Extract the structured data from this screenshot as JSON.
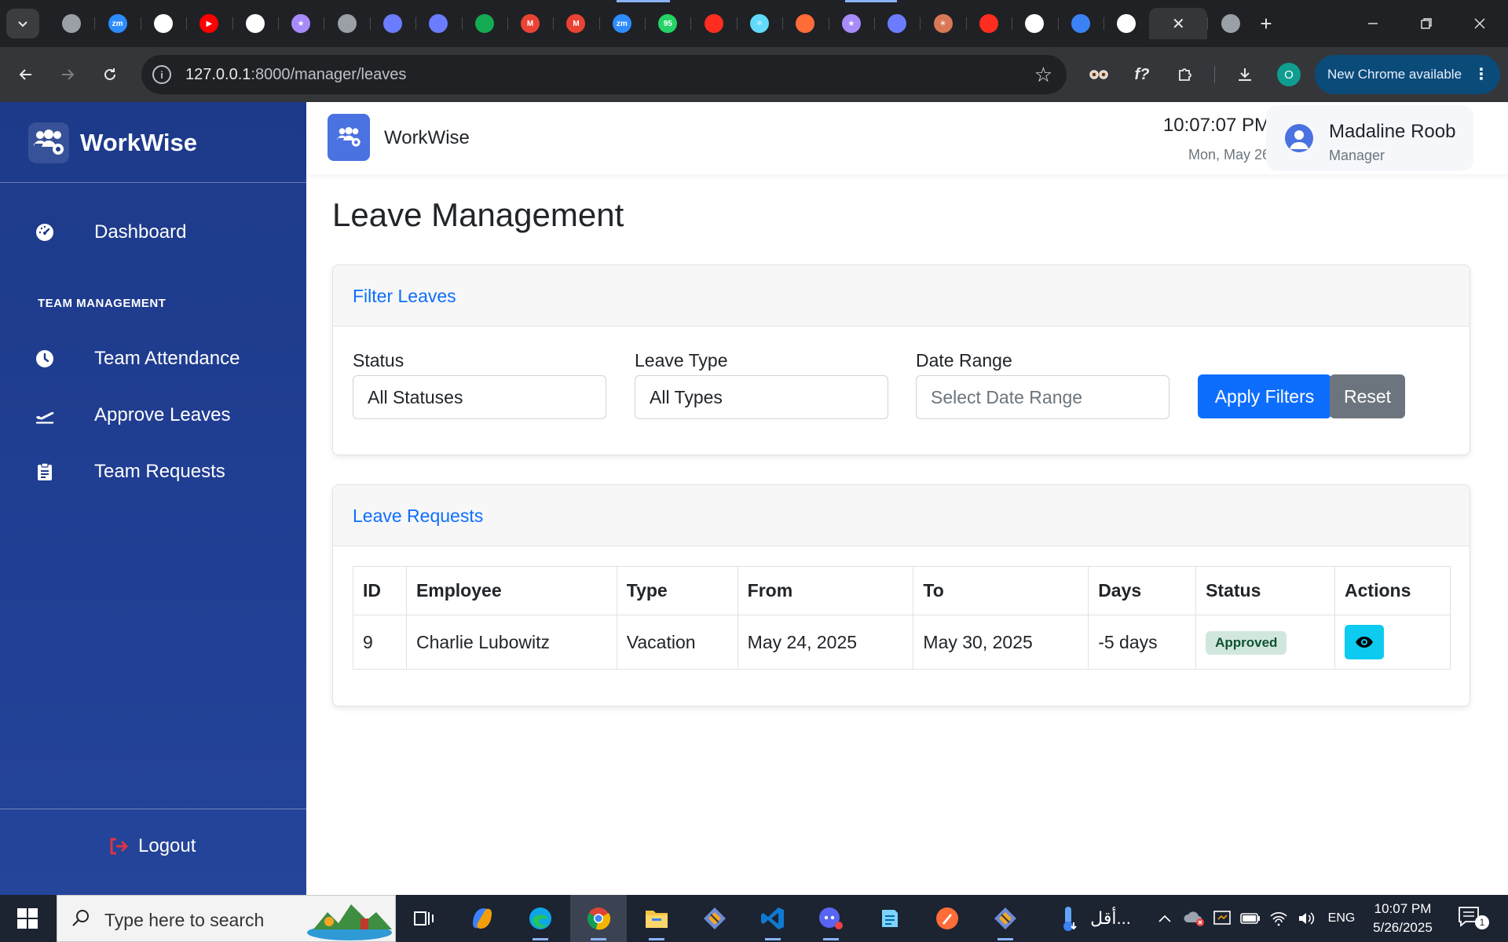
{
  "browser": {
    "url_host": "127.0.0.1",
    "url_path": ":8000/manager/leaves",
    "update_label": "New Chrome available",
    "profile_initial": "O",
    "tabs": [
      {
        "icon": "chrome-icon",
        "color": "#9aa0a6",
        "glyph": ""
      },
      {
        "icon": "zoom-icon",
        "color": "#2d8cff",
        "glyph": "zm"
      },
      {
        "icon": "github-icon",
        "color": "#ffffff",
        "glyph": ""
      },
      {
        "icon": "youtube-icon",
        "color": "#ff0000",
        "glyph": "▶"
      },
      {
        "icon": "openai-icon",
        "color": "#ffffff",
        "glyph": ""
      },
      {
        "icon": "vite-icon",
        "color": "#a78bfa",
        "glyph": "★"
      },
      {
        "icon": "globe-icon",
        "color": "#9aa0a6",
        "glyph": ""
      },
      {
        "icon": "tailwind-icon",
        "color": "#6b7cff",
        "glyph": ""
      },
      {
        "icon": "tailwind-icon",
        "color": "#6b7cff",
        "glyph": ""
      },
      {
        "icon": "mongodb-icon",
        "color": "#13aa52",
        "glyph": ""
      },
      {
        "icon": "gmail-icon",
        "color": "#ea4335",
        "glyph": "M"
      },
      {
        "icon": "gmail-icon",
        "color": "#ea4335",
        "glyph": "M"
      },
      {
        "icon": "zoom-icon",
        "color": "#2d8cff",
        "glyph": "zm"
      },
      {
        "icon": "whatsapp-icon",
        "color": "#25d366",
        "glyph": "95"
      },
      {
        "icon": "laravel-icon",
        "color": "#ff2d20",
        "glyph": ""
      },
      {
        "icon": "react-icon",
        "color": "#61dafb",
        "glyph": "⚛"
      },
      {
        "icon": "postman-icon",
        "color": "#ff6c37",
        "glyph": ""
      },
      {
        "icon": "vite-icon",
        "color": "#a78bfa",
        "glyph": "★"
      },
      {
        "icon": "tailwind-icon",
        "color": "#6b7cff",
        "glyph": ""
      },
      {
        "icon": "claude-icon",
        "color": "#d97757",
        "glyph": "✳"
      },
      {
        "icon": "laravel-icon",
        "color": "#ff2d20",
        "glyph": ""
      },
      {
        "icon": "openai-icon",
        "color": "#ffffff",
        "glyph": ""
      },
      {
        "icon": "share-icon",
        "color": "#3b82f6",
        "glyph": ""
      },
      {
        "icon": "terminal-icon",
        "color": "#ffffff",
        "glyph": ""
      },
      {
        "icon": "close-icon",
        "color": "#e8eaed",
        "glyph": "✕",
        "active": true
      },
      {
        "icon": "globe-icon",
        "color": "#9aa0a6",
        "glyph": ""
      }
    ]
  },
  "app": {
    "brand": "WorkWise",
    "sidebar": {
      "dashboard": "Dashboard",
      "section_heading": "TEAM MANAGEMENT",
      "items": [
        {
          "label": "Team Attendance",
          "icon": "clock-icon"
        },
        {
          "label": "Approve Leaves",
          "icon": "plane-icon"
        },
        {
          "label": "Team Requests",
          "icon": "clipboard-icon"
        }
      ],
      "logout": "Logout"
    },
    "header": {
      "brand": "WorkWise",
      "time": "10:07:07 PM",
      "date": "Mon, May 26",
      "user_name": "Madaline Roob",
      "user_role": "Manager"
    }
  },
  "page": {
    "title": "Leave Management",
    "filter": {
      "title": "Filter Leaves",
      "status_label": "Status",
      "status_value": "All Statuses",
      "type_label": "Leave Type",
      "type_value": "All Types",
      "date_label": "Date Range",
      "date_placeholder": "Select Date Range",
      "apply_label": "Apply Filters",
      "reset_label": "Reset"
    },
    "requests": {
      "title": "Leave Requests",
      "columns": [
        "ID",
        "Employee",
        "Type",
        "From",
        "To",
        "Days",
        "Status",
        "Actions"
      ],
      "rows": [
        {
          "id": "9",
          "employee": "Charlie Lubowitz",
          "type": "Vacation",
          "from": "May 24, 2025",
          "to": "May 30, 2025",
          "days": "-5 days",
          "status": "Approved"
        }
      ]
    }
  },
  "taskbar": {
    "search_placeholder": "Type here to search",
    "weather_text": "أقل...",
    "lang": "ENG",
    "time": "10:07 PM",
    "date": "5/26/2025",
    "notifications": "1"
  },
  "colors": {
    "primary": "#0d6efd",
    "secondary": "#6c757d",
    "info": "#0dcaf0",
    "success_bg": "#d1e7dd",
    "success_text": "#0f5132",
    "sidebar_bg": "#1d3a8a"
  }
}
